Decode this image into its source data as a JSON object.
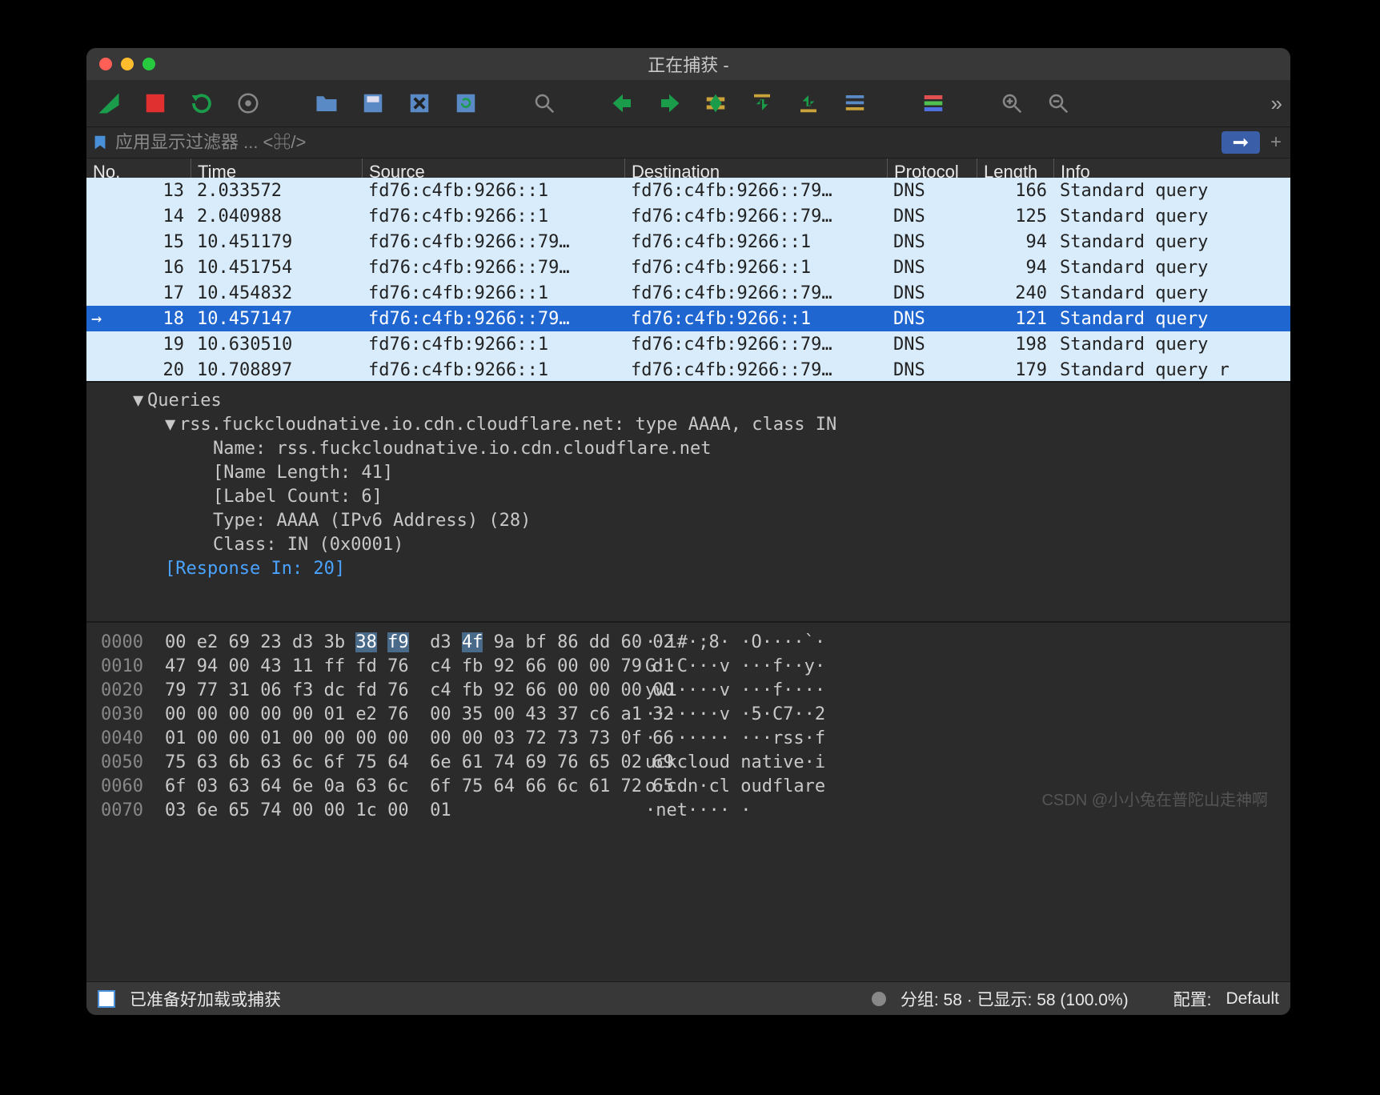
{
  "window": {
    "title": "正在捕获 -"
  },
  "filter": {
    "placeholder": "应用显示过滤器 ... <⌘/>"
  },
  "columns": {
    "no": "No.",
    "time": "Time",
    "source": "Source",
    "destination": "Destination",
    "protocol": "Protocol",
    "length": "Length",
    "info": "Info"
  },
  "packets": [
    {
      "no": "13",
      "time": "2.033572",
      "src": "fd76:c4fb:9266::1",
      "dst": "fd76:c4fb:9266::79…",
      "proto": "DNS",
      "len": "166",
      "info": "Standard query",
      "sel": false,
      "partial": true
    },
    {
      "no": "14",
      "time": "2.040988",
      "src": "fd76:c4fb:9266::1",
      "dst": "fd76:c4fb:9266::79…",
      "proto": "DNS",
      "len": "125",
      "info": "Standard query",
      "sel": false
    },
    {
      "no": "15",
      "time": "10.451179",
      "src": "fd76:c4fb:9266::79…",
      "dst": "fd76:c4fb:9266::1",
      "proto": "DNS",
      "len": "94",
      "info": "Standard query",
      "sel": false
    },
    {
      "no": "16",
      "time": "10.451754",
      "src": "fd76:c4fb:9266::79…",
      "dst": "fd76:c4fb:9266::1",
      "proto": "DNS",
      "len": "94",
      "info": "Standard query",
      "sel": false
    },
    {
      "no": "17",
      "time": "10.454832",
      "src": "fd76:c4fb:9266::1",
      "dst": "fd76:c4fb:9266::79…",
      "proto": "DNS",
      "len": "240",
      "info": "Standard query",
      "sel": false
    },
    {
      "no": "18",
      "time": "10.457147",
      "src": "fd76:c4fb:9266::79…",
      "dst": "fd76:c4fb:9266::1",
      "proto": "DNS",
      "len": "121",
      "info": "Standard query",
      "sel": true
    },
    {
      "no": "19",
      "time": "10.630510",
      "src": "fd76:c4fb:9266::1",
      "dst": "fd76:c4fb:9266::79…",
      "proto": "DNS",
      "len": "198",
      "info": "Standard query",
      "sel": false
    },
    {
      "no": "20",
      "time": "10.708897",
      "src": "fd76:c4fb:9266::1",
      "dst": "fd76:c4fb:9266::79…",
      "proto": "DNS",
      "len": "179",
      "info": "Standard query r",
      "sel": false,
      "partial": true
    }
  ],
  "detail": {
    "h1": "Queries",
    "h2": "rss.fuckcloudnative.io.cdn.cloudflare.net: type AAAA, class IN",
    "name": "Name: rss.fuckcloudnative.io.cdn.cloudflare.net",
    "nlen": "[Name Length: 41]",
    "lcount": "[Label Count: 6]",
    "type": "Type: AAAA (IPv6 Address) (28)",
    "cls": "Class: IN (0x0001)",
    "resp": "[Response In: 20]"
  },
  "hex": [
    {
      "off": "0000",
      "b": "00 e2 69 23 d3 3b 38 f9  d3 4f 9a bf 86 dd 60 02",
      "a": "··i#·;8· ·O····`·",
      "hl": [
        6,
        7,
        9
      ]
    },
    {
      "off": "0010",
      "b": "47 94 00 43 11 ff fd 76  c4 fb 92 66 00 00 79 d1",
      "a": "G··C···v ···f··y·"
    },
    {
      "off": "0020",
      "b": "79 77 31 06 f3 dc fd 76  c4 fb 92 66 00 00 00 00",
      "a": "yw1····v ···f····"
    },
    {
      "off": "0030",
      "b": "00 00 00 00 00 01 e2 76  00 35 00 43 37 c6 a1 32",
      "a": "·······v ·5·C7··2"
    },
    {
      "off": "0040",
      "b": "01 00 00 01 00 00 00 00  00 00 03 72 73 73 0f 66",
      "a": "········ ···rss·f"
    },
    {
      "off": "0050",
      "b": "75 63 6b 63 6c 6f 75 64  6e 61 74 69 76 65 02 69",
      "a": "uckcloud native·i"
    },
    {
      "off": "0060",
      "b": "6f 03 63 64 6e 0a 63 6c  6f 75 64 66 6c 61 72 65",
      "a": "o·cdn·cl oudflare"
    },
    {
      "off": "0070",
      "b": "03 6e 65 74 00 00 1c 00  01",
      "a": "·net···· ·"
    }
  ],
  "status": {
    "ready": "已准备好加载或捕获",
    "stats": "分组: 58 · 已显示: 58 (100.0%)",
    "profile_label": "配置:",
    "profile_value": "Default"
  },
  "watermark": "CSDN @小小兔在普陀山走神啊"
}
